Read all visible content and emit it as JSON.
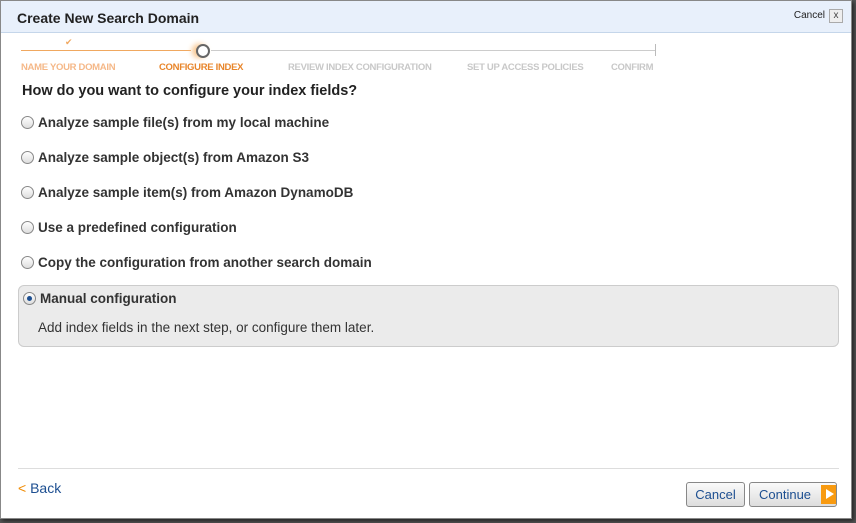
{
  "dialog": {
    "title": "Create New Search Domain",
    "cancel_top": "Cancel",
    "close": "x"
  },
  "steps": [
    {
      "label": "NAME YOUR DOMAIN",
      "state": "done"
    },
    {
      "label": "CONFIGURE INDEX",
      "state": "current"
    },
    {
      "label": "REVIEW INDEX CONFIGURATION",
      "state": "todo"
    },
    {
      "label": "SET UP ACCESS POLICIES",
      "state": "todo"
    },
    {
      "label": "CONFIRM",
      "state": "todo"
    }
  ],
  "question": "How do you want to configure your index fields?",
  "options": [
    {
      "label": "Analyze sample file(s) from my local machine",
      "selected": false
    },
    {
      "label": "Analyze sample object(s) from Amazon S3",
      "selected": false
    },
    {
      "label": "Analyze sample item(s) from Amazon DynamoDB",
      "selected": false
    },
    {
      "label": "Use a predefined configuration",
      "selected": false
    },
    {
      "label": "Copy the configuration from another search domain",
      "selected": false
    },
    {
      "label": "Manual configuration",
      "selected": true,
      "description": "Add index fields in the next step, or configure them later."
    }
  ],
  "footer": {
    "back_arrow": "<",
    "back": "Back",
    "cancel": "Cancel",
    "continue": "Continue"
  },
  "colors": {
    "accent": "#f89a10",
    "link": "#1d4f91"
  }
}
